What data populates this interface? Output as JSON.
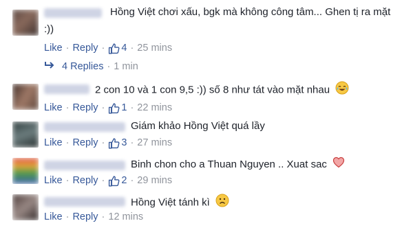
{
  "ui": {
    "like_label": "Like",
    "reply_label": "Reply",
    "separator": "·"
  },
  "comments": [
    {
      "text": "Hồng Việt chơi xấu, bgk mà không công tâm... Ghen tị ra mặt",
      "text_line2": ":))",
      "likes": "4",
      "time": "25 mins",
      "replies": {
        "label": "4 Replies",
        "time": "1 min"
      }
    },
    {
      "text": "2 con 10 và 1 con 9,5 :)) số 8 như tát vào mặt nhau",
      "emoji": "crying-laughing-emoji",
      "likes": "1",
      "time": "22 mins"
    },
    {
      "text": "Giám khảo Hồng Việt quá lầy",
      "likes": "3",
      "time": "27 mins"
    },
    {
      "text": "Binh chon cho a Thuan Nguyen .. Xuat sac",
      "emoji": "heart-emoji",
      "likes": "2",
      "time": "29 mins"
    },
    {
      "text": "Hồng Việt tánh kì",
      "emoji": "sad-face-emoji",
      "time": "12 mins"
    }
  ],
  "colors": {
    "link": "#365899",
    "text": "#1d2129",
    "meta": "#90949c"
  }
}
